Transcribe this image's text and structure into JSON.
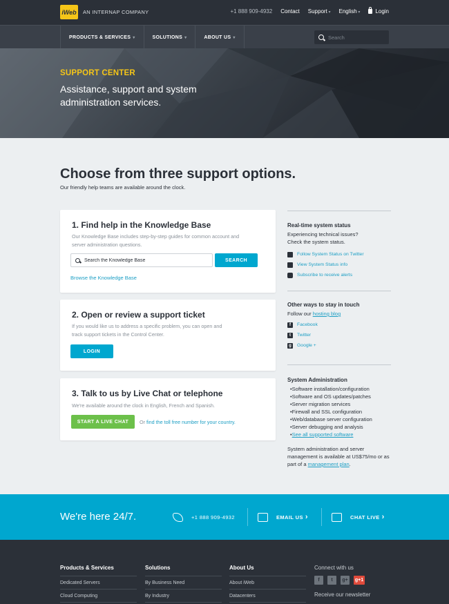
{
  "topbar": {
    "logo_text": "iWeb",
    "tagline": "AN INTERNAP COMPANY",
    "phone": "+1 888 909-4932",
    "contact": "Contact",
    "support": "Support",
    "language": "English",
    "login": "Login"
  },
  "mainnav": {
    "items": [
      "PRODUCTS & SERVICES",
      "SOLUTIONS",
      "ABOUT US"
    ],
    "search_placeholder": "Search"
  },
  "hero": {
    "kicker": "SUPPORT CENTER",
    "title": "Assistance, support and system administration services."
  },
  "intro": {
    "heading": "Choose from three support options.",
    "subheading": "Our friendly help teams are available around the clock."
  },
  "cards": {
    "kb": {
      "title": "1. Find help in the Knowledge Base",
      "desc": "Our Knowledge Base includes step-by-step guides for common account and server administration questions.",
      "input_placeholder": "Search the Knowledge Base",
      "button": "SEARCH",
      "browse": "Browse the Knowledge Base"
    },
    "ticket": {
      "title": "2. Open or review a support ticket",
      "desc": "If you would like us to address a specific problem, you can open and track support tickets in the Control Center.",
      "button": "LOGIN"
    },
    "chat": {
      "title": "3. Talk to us by Live Chat or telephone",
      "desc": "We're available around the clock in English, French and Spanish.",
      "button": "START A LIVE CHAT",
      "or": "Or",
      "link": "find the toll free number for your country."
    }
  },
  "sidebar": {
    "status": {
      "title": "Real-time system status",
      "text": "Experiencing technical issues? Check the system status.",
      "links": [
        "Follow System Status on Twitter",
        "View System Status info",
        "Subscribe to receive alerts"
      ]
    },
    "touch": {
      "title": "Other ways to stay in touch",
      "follow_prefix": "Follow our",
      "follow_link": "hosting blog",
      "links": [
        "Facebook",
        "Twitter",
        "Google +"
      ]
    },
    "sysadmin": {
      "title": "System Administration",
      "items": [
        "Software installation/configuration",
        "Software and OS updates/patches",
        "Server migration services",
        "Firewall and SSL configuration",
        "Web/database server configuration",
        "Server debugging and analysis"
      ],
      "see_all": "See all supported software",
      "note": "System administration and server management is available at US$75/mo or as part of a",
      "note_link": "management plan",
      "note_end": "."
    }
  },
  "band": {
    "slogan": "We're here 24/7.",
    "phone": "+1 888 909-4932",
    "email": "EMAIL US",
    "chat": "CHAT LIVE"
  },
  "footer": {
    "cols": [
      {
        "title": "Products & Services",
        "link": "Dedicated Servers",
        "link2": "Cloud Computing"
      },
      {
        "title": "Solutions",
        "link": "By Business Need",
        "link2": "By Industry"
      },
      {
        "title": "About Us",
        "link": "About iWeb",
        "link2": "Datacenters"
      }
    ],
    "connect": "Connect with us",
    "newsletter": "Receive our newsletter",
    "social": [
      "f",
      "t",
      "g+",
      "g+1"
    ]
  },
  "colors": {
    "accent": "#00a7cf",
    "brand_yellow": "#f5c518",
    "chat_green": "#6cc04a",
    "dark": "#2b3038"
  }
}
